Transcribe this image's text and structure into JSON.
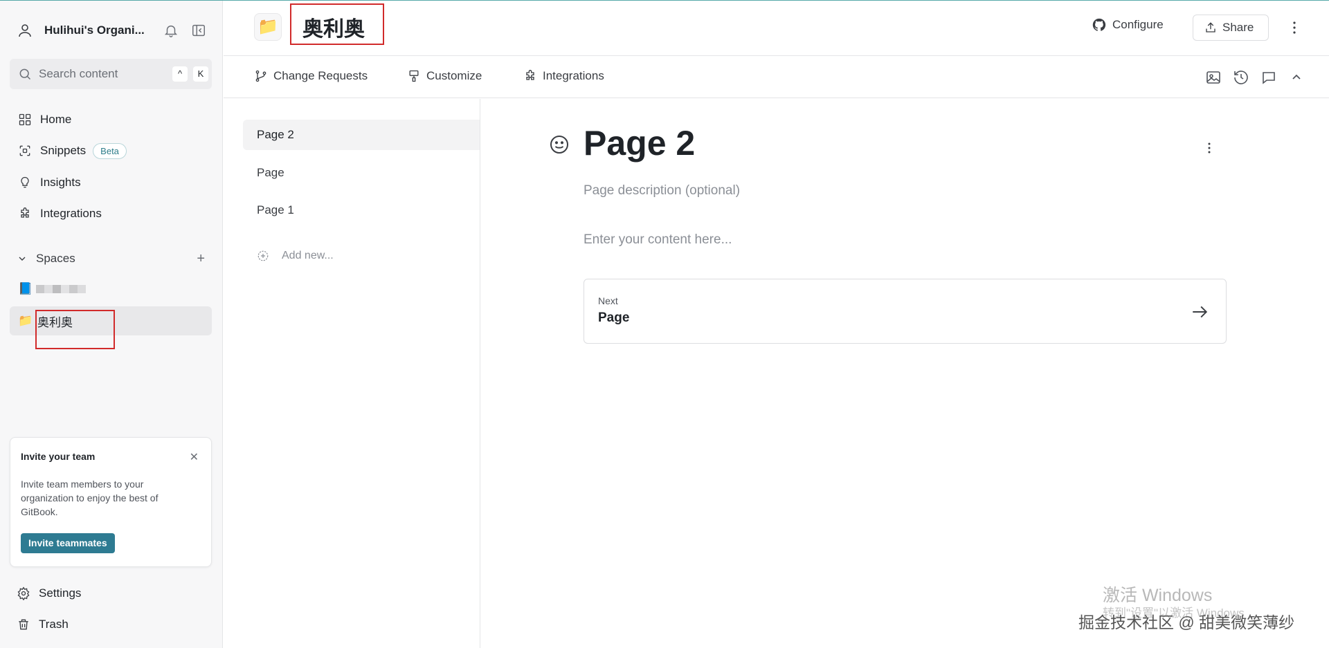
{
  "sidebar": {
    "org_name": "Hulihui's Organi...",
    "search": {
      "placeholder": "Search content",
      "shortcut_1": "^",
      "shortcut_2": "K"
    },
    "nav": [
      {
        "label": "Home",
        "icon": "grid-icon"
      },
      {
        "label": "Snippets",
        "icon": "snippet-icon",
        "badge": "Beta"
      },
      {
        "label": "Insights",
        "icon": "insights-icon"
      },
      {
        "label": "Integrations",
        "icon": "puzzle-icon"
      }
    ],
    "spaces_label": "Spaces",
    "spaces": [
      {
        "emoji": "📘",
        "label": ""
      },
      {
        "emoji": "📁",
        "label": "奥利奥"
      }
    ],
    "invite_card": {
      "title": "Invite your team",
      "body": "Invite team members to your organization to enjoy the best of GitBook.",
      "button": "Invite teammates"
    },
    "bottom": [
      {
        "label": "Settings",
        "icon": "gear-icon"
      },
      {
        "label": "Trash",
        "icon": "trash-icon"
      }
    ]
  },
  "header": {
    "space_emoji": "📁",
    "space_title": "奥利奥",
    "configure_label": "Configure",
    "share_label": "Share"
  },
  "tabs": [
    {
      "label": "Change Requests",
      "icon": "branch-icon"
    },
    {
      "label": "Customize",
      "icon": "paint-icon"
    },
    {
      "label": "Integrations",
      "icon": "puzzle-icon"
    }
  ],
  "pages": [
    {
      "label": "Page 2",
      "active": true
    },
    {
      "label": "Page",
      "active": false
    },
    {
      "label": "Page 1",
      "active": false
    }
  ],
  "add_new_label": "Add new...",
  "main": {
    "title": "Page 2",
    "description_placeholder": "Page description (optional)",
    "content_placeholder": "Enter your content here...",
    "next": {
      "label": "Next",
      "title": "Page"
    }
  },
  "overlay": {
    "windows_line_1": "激活 Windows",
    "windows_line_2": "转到\"设置\"以激活 Windows",
    "site_watermark": "掘金技术社区 @ 甜美微笑薄纱"
  },
  "colors": {
    "accent": "#2e7b92",
    "highlight_box": "#d12a2a"
  }
}
